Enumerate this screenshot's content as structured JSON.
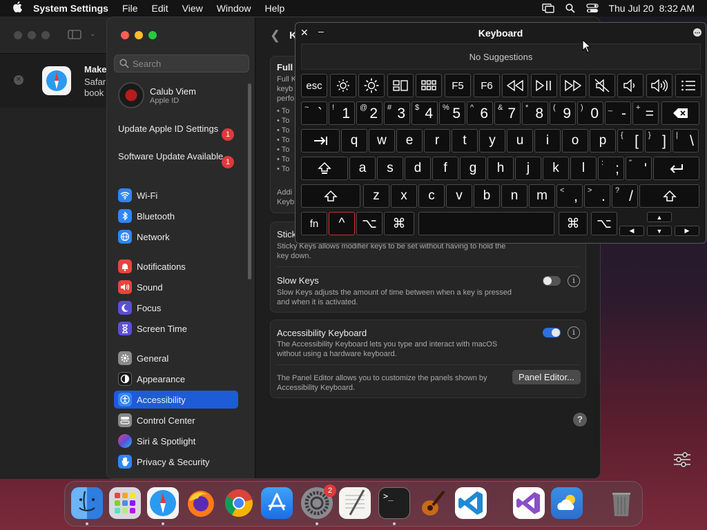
{
  "menubar": {
    "app_name": "System Settings",
    "menus": [
      "File",
      "Edit",
      "View",
      "Window",
      "Help"
    ],
    "datetime": "Thu Jul 20  8:32 AM"
  },
  "bg_notification": {
    "title": "Make",
    "line1": "Safar",
    "line2": "book"
  },
  "sidebar": {
    "search_placeholder": "Search",
    "user_name": "Calub Viem",
    "user_sub": "Apple ID",
    "alerts": [
      {
        "label": "Update Apple ID Settings",
        "badge": "1"
      },
      {
        "label": "Software Update Available",
        "badge": "1"
      }
    ],
    "items": [
      {
        "label": "Wi-Fi",
        "icon": "wifi-icon",
        "color": "#2f86f5"
      },
      {
        "label": "Bluetooth",
        "icon": "bluetooth-icon",
        "color": "#2f86f5"
      },
      {
        "label": "Network",
        "icon": "globe-icon",
        "color": "#2f86f5"
      },
      {
        "label": "Notifications",
        "icon": "bell-icon",
        "color": "#e8443f"
      },
      {
        "label": "Sound",
        "icon": "speaker-icon",
        "color": "#e8443f"
      },
      {
        "label": "Focus",
        "icon": "moon-icon",
        "color": "#5b4fd6"
      },
      {
        "label": "Screen Time",
        "icon": "hourglass-icon",
        "color": "#5b4fd6"
      },
      {
        "label": "General",
        "icon": "gear-icon",
        "color": "#8a8a8a"
      },
      {
        "label": "Appearance",
        "icon": "appearance-icon",
        "color": "#1a1a1a"
      },
      {
        "label": "Accessibility",
        "icon": "accessibility-icon",
        "color": "#2f86f5"
      },
      {
        "label": "Control Center",
        "icon": "control-center-icon",
        "color": "#8a8a8a"
      },
      {
        "label": "Siri & Spotlight",
        "icon": "siri-icon",
        "color": "#a030d0"
      },
      {
        "label": "Privacy & Security",
        "icon": "hand-icon",
        "color": "#2f86f5"
      }
    ],
    "selected": "Accessibility"
  },
  "content": {
    "title": "K",
    "full_card": {
      "title": "Full",
      "desc_lines": [
        "Full K",
        "keyb",
        "perfo"
      ],
      "bullets": [
        "• To",
        "• To",
        "• To",
        "• To",
        "• To",
        "• To",
        "• To"
      ],
      "footer_lines": [
        "Addi",
        "Keyb"
      ]
    },
    "sticky_keys": {
      "title": "Stick",
      "desc_line1": "Sticky Keys allows modifier keys to be set without having to hold the",
      "desc_line2": "key down."
    },
    "slow_keys": {
      "title": "Slow Keys",
      "desc_line1": "Slow Keys adjusts the amount of time between when a key is pressed",
      "desc_line2": "and when it is activated.",
      "enabled": false
    },
    "accessibility_keyboard": {
      "title": "Accessibility Keyboard",
      "desc_line1": "The Accessibility Keyboard lets you type and interact with macOS",
      "desc_line2": "without using a hardware keyboard.",
      "enabled": true,
      "panel_desc_line1": "The Panel Editor allows you to customize the panels shown by",
      "panel_desc_line2": "Accessibility Keyboard.",
      "panel_button": "Panel Editor..."
    },
    "help": "?"
  },
  "keyboard": {
    "title": "Keyboard",
    "close": "✕",
    "minimize": "–",
    "suggestions": "No Suggestions",
    "fn_row": [
      "esc",
      "brightness-down-icon",
      "brightness-up-icon",
      "mission-control-icon",
      "launchpad-icon",
      "F5",
      "F6",
      "rewind-icon",
      "play-pause-icon",
      "fast-forward-icon",
      "mute-icon",
      "volume-down-icon",
      "volume-up-icon",
      "list-icon"
    ],
    "num_row": [
      {
        "main": "`",
        "shift": "~"
      },
      {
        "main": "1",
        "shift": "!"
      },
      {
        "main": "2",
        "shift": "@"
      },
      {
        "main": "3",
        "shift": "#"
      },
      {
        "main": "4",
        "shift": "$"
      },
      {
        "main": "5",
        "shift": "%"
      },
      {
        "main": "6",
        "shift": "^"
      },
      {
        "main": "7",
        "shift": "&"
      },
      {
        "main": "8",
        "shift": "*"
      },
      {
        "main": "9",
        "shift": "("
      },
      {
        "main": "0",
        "shift": ")"
      },
      {
        "main": "-",
        "shift": "_"
      },
      {
        "main": "=",
        "shift": "+"
      }
    ],
    "row_q": [
      "q",
      "w",
      "e",
      "r",
      "t",
      "y",
      "u",
      "i",
      "o",
      "p"
    ],
    "row_q_extra": [
      {
        "main": "[",
        "shift": "{"
      },
      {
        "main": "]",
        "shift": "}"
      },
      {
        "main": "\\",
        "shift": "|"
      }
    ],
    "row_a": [
      "a",
      "s",
      "d",
      "f",
      "g",
      "h",
      "j",
      "k",
      "l"
    ],
    "row_a_extra": [
      {
        "main": ";",
        "shift": ":"
      },
      {
        "main": "'",
        "shift": "\""
      }
    ],
    "row_z": [
      "z",
      "x",
      "c",
      "v",
      "b",
      "n",
      "m"
    ],
    "row_z_extra": [
      {
        "main": ",",
        "shift": "<"
      },
      {
        "main": ".",
        "shift": ">"
      },
      {
        "main": "/",
        "shift": "?"
      }
    ],
    "bottom": {
      "fn": "fn",
      "ctrl": "^",
      "option": "⌥",
      "command": "⌘"
    }
  },
  "dock": {
    "apps": [
      "finder-icon",
      "launchpad-icon",
      "safari-icon",
      "firefox-icon",
      "chrome-icon",
      "app-store-icon",
      "system-settings-icon",
      "textedit-icon",
      "terminal-icon",
      "garageband-icon",
      "vscode-icon",
      "visual-studio-icon",
      "weather-icon",
      "trash-icon"
    ],
    "settings_badge": "2",
    "terminal_label": ">_"
  }
}
